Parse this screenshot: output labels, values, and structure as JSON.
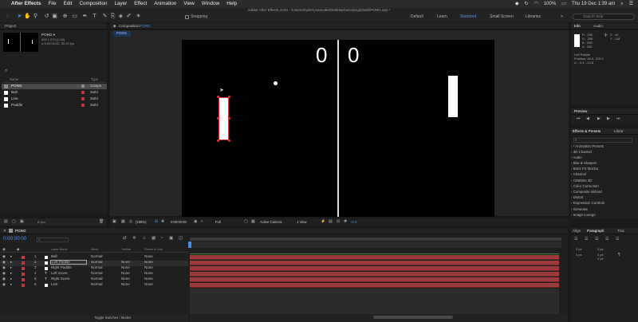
{
  "menubar": {
    "app": "After Effects",
    "items": [
      "File",
      "Edit",
      "Composition",
      "Layer",
      "Effect",
      "Animation",
      "View",
      "Window",
      "Help"
    ],
    "battery": "100%",
    "clock": "Thu 19 Dec  1:39 am"
  },
  "window_title": "Adobe After Effects 2020 - /Users/mysterysancake/Desktop/aeleaknglobals/PONG.aep *",
  "toolbar": {
    "snapping": "Snapping",
    "workspaces": [
      "Default",
      "Learn",
      "Standard",
      "Small Screen",
      "Libraries"
    ],
    "active_workspace": "Standard",
    "search_placeholder": "Search Help"
  },
  "project": {
    "tab": "Project",
    "comp_name": "PONG ▾",
    "comp_info1": "800 x 270 (1.00)",
    "comp_info2": "Δ 0:00:00:32, 30.00 fps",
    "col_name": "Name",
    "col_type": "Type",
    "items": [
      {
        "name": "PONG",
        "type": "Compo",
        "selected": true
      },
      {
        "name": "Ball",
        "type": "Solid"
      },
      {
        "name": "Line",
        "type": "Solid"
      },
      {
        "name": "Paddle",
        "type": "Solid"
      }
    ],
    "bpc": "8 bpc"
  },
  "composition": {
    "tab": "Composition",
    "tab_name": "PONG",
    "subtab": "PONG",
    "score_left": "0",
    "score_right": "0",
    "zoom": "(196%)",
    "timecode": "0:00:00:00",
    "resolution": "Full",
    "camera": "Active Camera",
    "views": "1 View",
    "exposure": "+0.0"
  },
  "info": {
    "tab": "Info",
    "tab2": "Audio",
    "r": "R : 255",
    "g": "G : 255",
    "b": "B : 255",
    "a": "A : 255",
    "x": "X : 40",
    "y": "Y : 118",
    "layer": "Left Paddle",
    "pos": "Position: 40.0, 120.0",
    "delta": "Δ : -3.1, -14.8"
  },
  "preview": {
    "tab": "Preview"
  },
  "effects": {
    "tab": "Effects & Presets",
    "tab2": "Librar",
    "items": [
      "* Animation Presets",
      "3D Channel",
      "Audio",
      "Blur & Sharpen",
      "Boris FX Mocha",
      "Channel",
      "CINEMA 4D",
      "Color Correction",
      "Composite Wizard",
      "Distort",
      "Expression Controls",
      "Generate",
      "Image Lounge"
    ]
  },
  "timeline": {
    "tab": "PONG",
    "timecode": "0:00:00:00",
    "headers": {
      "layer": "Layer Name",
      "mode": "Mode",
      "trkmat": "TrkMat",
      "parent": "Parent & Link"
    },
    "layers": [
      {
        "num": "1",
        "name": "Ball",
        "mode": "Normal",
        "trk": "",
        "parent": "None"
      },
      {
        "num": "2",
        "name": "Left Paddle",
        "mode": "Normal",
        "trk": "None",
        "parent": "None"
      },
      {
        "num": "3",
        "name": "Right Paddle",
        "mode": "Normal",
        "trk": "None",
        "parent": "None"
      },
      {
        "num": "4",
        "name": "Left Score",
        "mode": "Normal",
        "trk": "None",
        "parent": "None"
      },
      {
        "num": "5",
        "name": "Right Score",
        "mode": "Normal",
        "trk": "None",
        "parent": "None"
      },
      {
        "num": "6",
        "name": "Line",
        "mode": "Normal",
        "trk": "None",
        "parent": "None"
      }
    ],
    "footer": "Toggle Switches / Modes"
  },
  "paragraph": {
    "tabs": [
      "Align",
      "Paragraph",
      "Trac"
    ],
    "fields": [
      "0 px",
      "0 px",
      "0 px",
      "0 px",
      "0 px"
    ]
  },
  "colors": {
    "accent": "#4d8bea",
    "track": "#9d3a3e",
    "label_red": "#c4383d"
  }
}
